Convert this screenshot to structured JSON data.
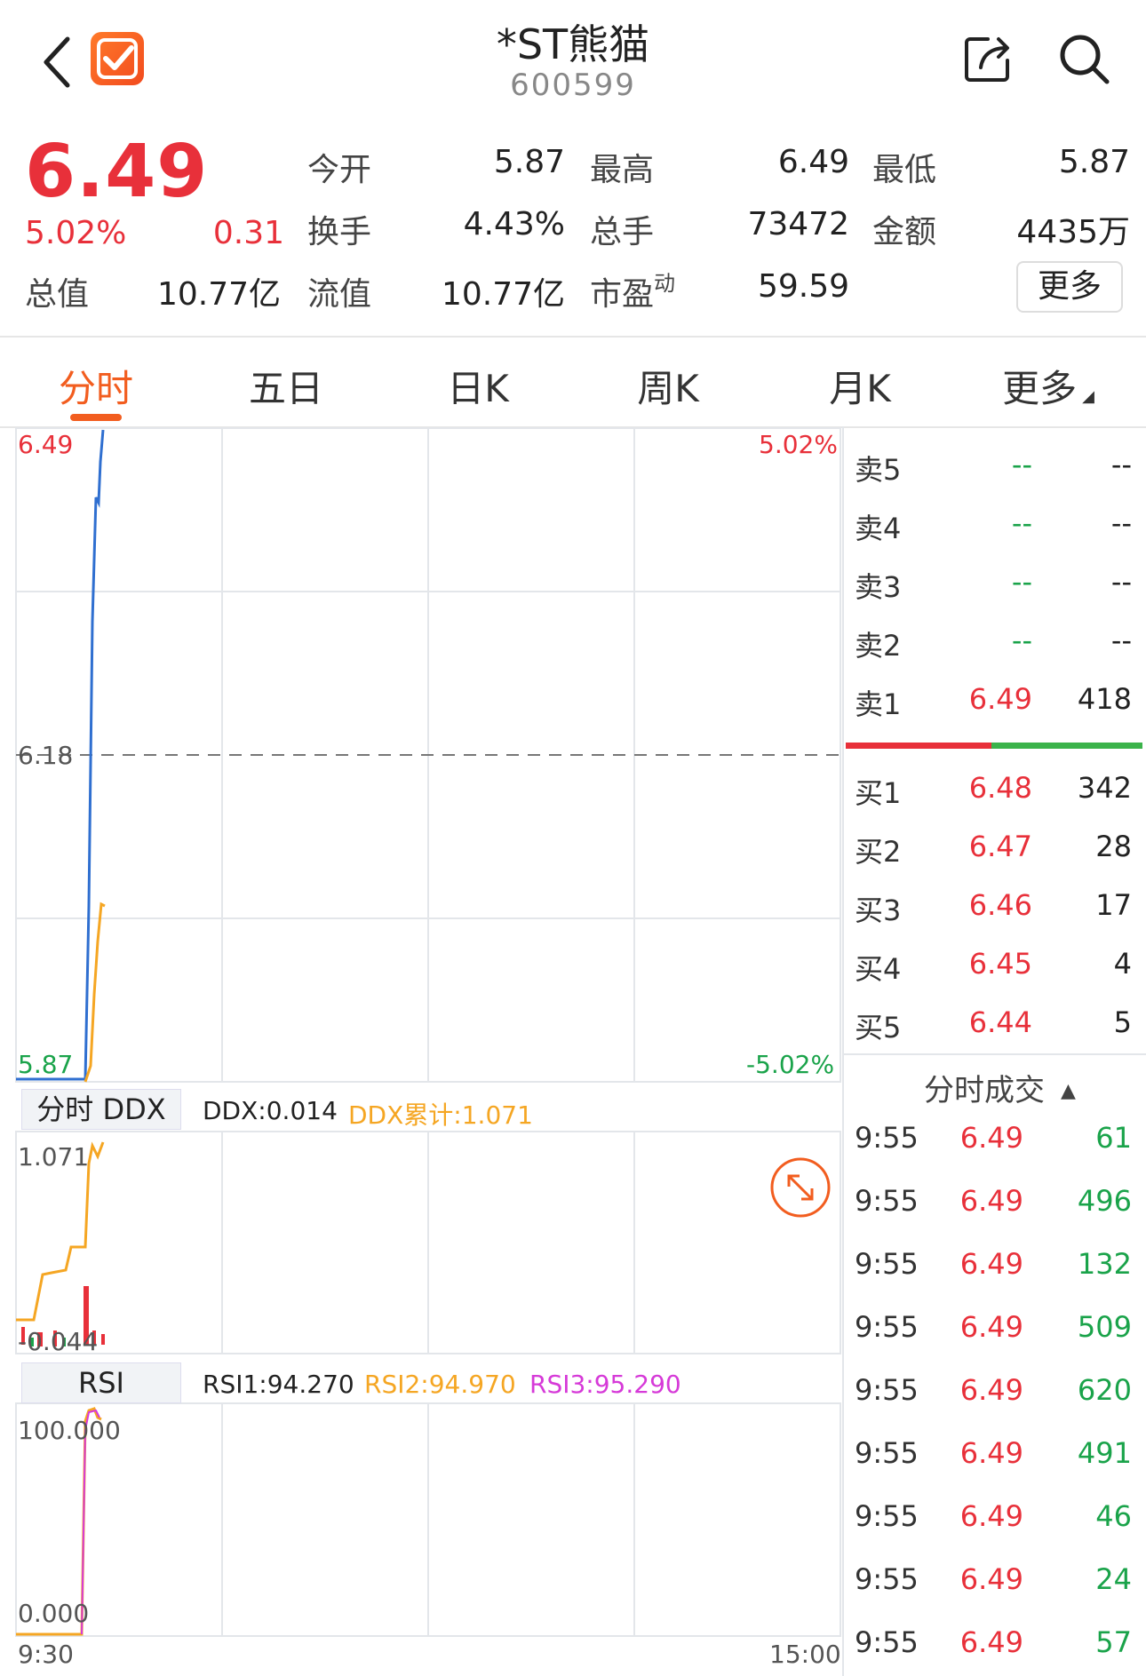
{
  "header": {
    "title": "*ST熊猫",
    "code": "600599",
    "back_icon": "chevron-left-icon",
    "logo_icon": "app-checkmark-logo",
    "share_icon": "share-icon",
    "search_icon": "search-icon"
  },
  "quote": {
    "price": "6.49",
    "change_pct": "5.02%",
    "change": "0.31",
    "fields": {
      "open_label": "今开",
      "open_value": "5.87",
      "high_label": "最高",
      "high_value": "6.49",
      "low_label": "最低",
      "low_value": "5.87",
      "turnover_label": "换手",
      "turnover_value": "4.43%",
      "volume_label": "总手",
      "volume_value": "73472",
      "amount_label": "金额",
      "amount_value": "4435万",
      "mktcap_label": "总值",
      "mktcap_value": "10.77亿",
      "float_label": "流值",
      "float_value": "10.77亿",
      "pe_label": "市盈",
      "pe_sup": "动",
      "pe_value": "59.59"
    },
    "more_label": "更多"
  },
  "tabs": [
    {
      "label": "分时"
    },
    {
      "label": "五日"
    },
    {
      "label": "日K"
    },
    {
      "label": "周K"
    },
    {
      "label": "月K"
    },
    {
      "label": "更多"
    }
  ],
  "main_chart": {
    "y_top": "6.49",
    "y_mid": "6.18",
    "y_bottom": "5.87",
    "pct_top": "5.02%",
    "pct_bottom": "-5.02%",
    "x_start": "9:30",
    "x_end": "15:00"
  },
  "ddx": {
    "tag": "分时 DDX",
    "ddx_text": "DDX:0.014",
    "ddx_cum_text": "DDX累计:1.071",
    "y_top": "1.071",
    "y_bottom": "-0.044",
    "zoom_icon": "expand-arrows-icon"
  },
  "rsi": {
    "tag": "RSI",
    "rsi1": "RSI1:94.270",
    "rsi2": "RSI2:94.970",
    "rsi3": "RSI3:95.290",
    "y_top": "100.000",
    "y_bottom": "0.000"
  },
  "order_book": {
    "asks": [
      {
        "label": "卖5",
        "price": "--",
        "vol": "--"
      },
      {
        "label": "卖4",
        "price": "--",
        "vol": "--"
      },
      {
        "label": "卖3",
        "price": "--",
        "vol": "--"
      },
      {
        "label": "卖2",
        "price": "--",
        "vol": "--"
      },
      {
        "label": "卖1",
        "price": "6.49",
        "vol": "418"
      }
    ],
    "bids": [
      {
        "label": "买1",
        "price": "6.48",
        "vol": "342"
      },
      {
        "label": "买2",
        "price": "6.47",
        "vol": "28"
      },
      {
        "label": "买3",
        "price": "6.46",
        "vol": "17"
      },
      {
        "label": "买4",
        "price": "6.45",
        "vol": "4"
      },
      {
        "label": "买5",
        "price": "6.44",
        "vol": "5"
      }
    ]
  },
  "trades": {
    "title": "分时成交",
    "rows": [
      {
        "time": "9:55",
        "price": "6.49",
        "vol": "61"
      },
      {
        "time": "9:55",
        "price": "6.49",
        "vol": "496"
      },
      {
        "time": "9:55",
        "price": "6.49",
        "vol": "132"
      },
      {
        "time": "9:55",
        "price": "6.49",
        "vol": "509"
      },
      {
        "time": "9:55",
        "price": "6.49",
        "vol": "620"
      },
      {
        "time": "9:55",
        "price": "6.49",
        "vol": "491"
      },
      {
        "time": "9:55",
        "price": "6.49",
        "vol": "46"
      },
      {
        "time": "9:55",
        "price": "6.49",
        "vol": "24"
      },
      {
        "time": "9:55",
        "price": "6.49",
        "vol": "57"
      }
    ]
  },
  "colors": {
    "up": "#e8303a",
    "down": "#1aa34a",
    "accent": "#f25d1f",
    "price_line": "#2f6fd0",
    "avg_line": "#f5a623"
  }
}
